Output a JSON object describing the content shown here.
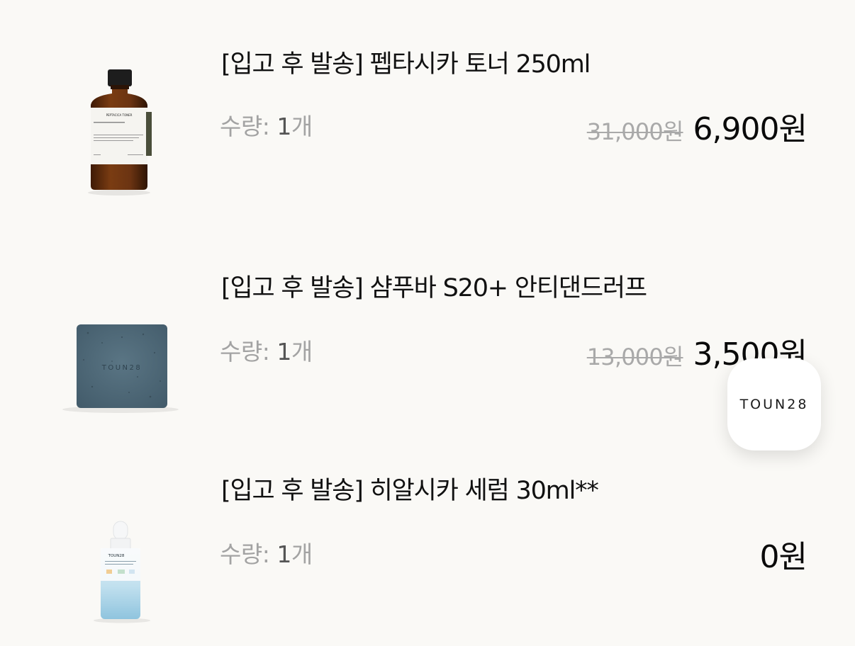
{
  "cart": {
    "items": [
      {
        "title": "[입고 후 발송] 펩타시카 토너 250ml",
        "qty_label": "수량:",
        "qty_value": "1",
        "qty_unit": "개",
        "original_price": "31,000원",
        "sale_price": "6,900원",
        "image_icon": "amber-bottle-icon",
        "image_label": "PEPTACICA TONER"
      },
      {
        "title": "[입고 후 발송] 샴푸바 S20+ 안티댄드러프",
        "qty_label": "수량:",
        "qty_value": "1",
        "qty_unit": "개",
        "original_price": "13,000원",
        "sale_price": "3,500원",
        "image_icon": "shampoo-bar-icon",
        "image_label": "TOUN28"
      },
      {
        "title": "[입고 후 발송] 히알시카 세럼 30ml**",
        "qty_label": "수량:",
        "qty_value": "1",
        "qty_unit": "개",
        "sale_price": "0원",
        "image_icon": "serum-dropper-bottle-icon",
        "image_label": "TOUN28"
      }
    ]
  },
  "brand_fab": {
    "label": "TOUN28"
  },
  "colors": {
    "background": "#faf9f6",
    "text_primary": "#111111",
    "text_muted": "#a3a3a3",
    "amber_bottle": "#6b3412",
    "soap_blue": "#4e6878",
    "serum_blue": "#a9d2e6"
  }
}
